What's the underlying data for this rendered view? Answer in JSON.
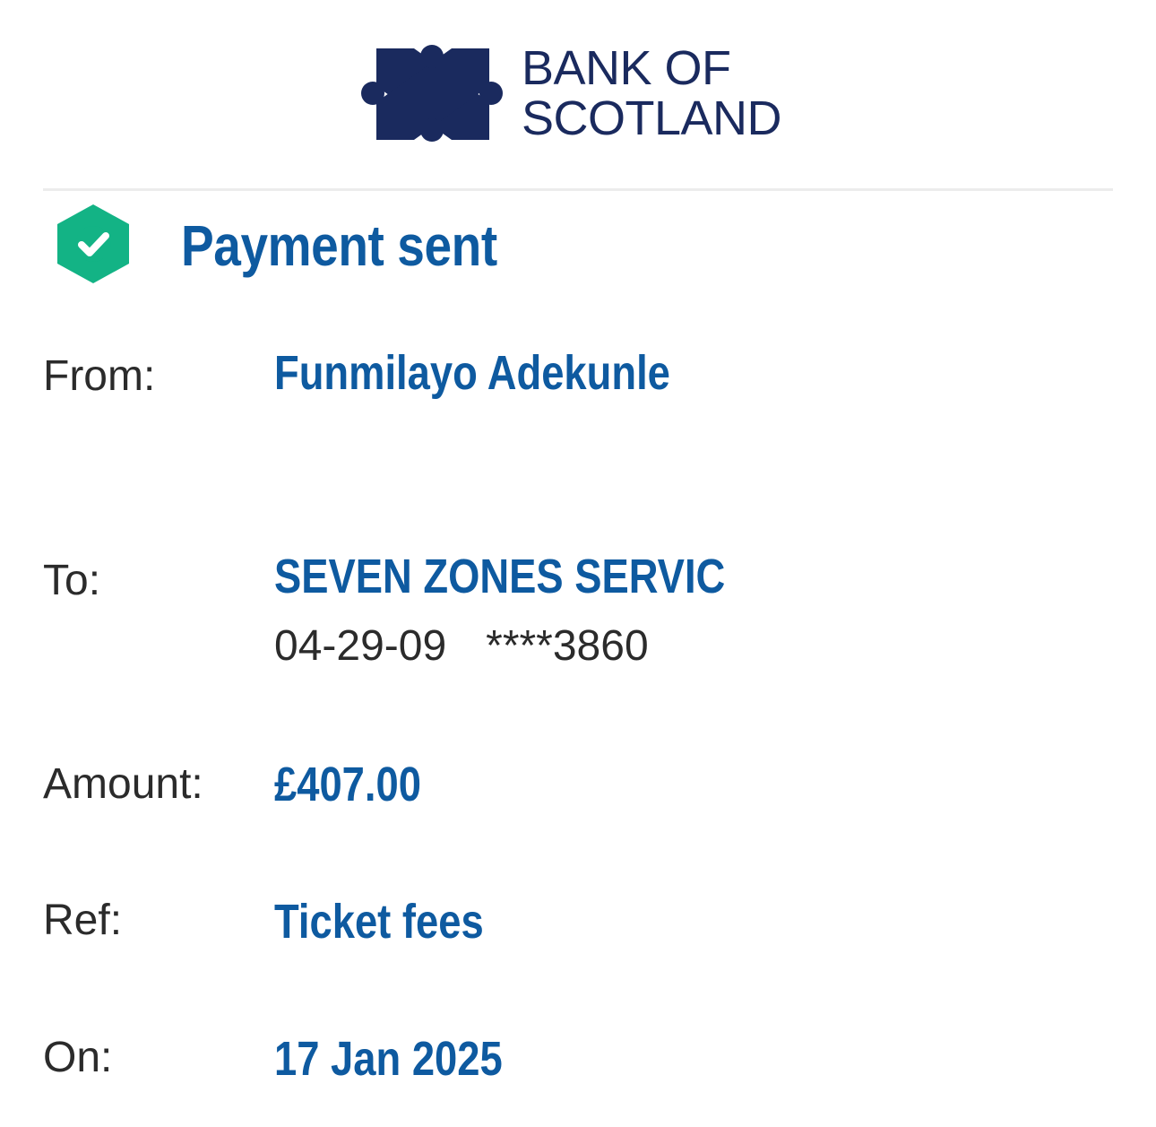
{
  "brand": {
    "name_line1": "BANK OF",
    "name_line2": "SCOTLAND",
    "color": "#1a2a5e"
  },
  "status": {
    "icon": "check-hexagon-icon",
    "icon_color": "#13b385",
    "title": "Payment sent",
    "title_color": "#0e5aa0"
  },
  "details": {
    "from_label": "From:",
    "from_value": "Funmilayo Adekunle",
    "to_label": "To:",
    "to_value": "SEVEN ZONES SERVIC",
    "to_sort_code": "04-29-09",
    "to_account": "****3860",
    "amount_label": "Amount:",
    "amount_value": "£407.00",
    "ref_label": "Ref:",
    "ref_value": "Ticket fees",
    "on_label": "On:",
    "on_value": "17 Jan 2025"
  }
}
